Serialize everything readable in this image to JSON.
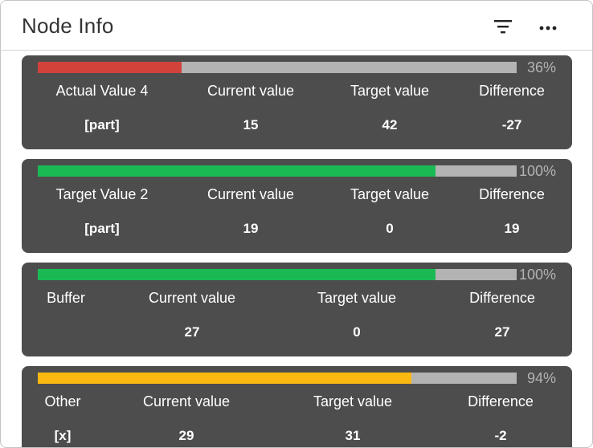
{
  "header": {
    "title": "Node Info",
    "filter_icon": "filter-icon",
    "more_icon": "more-horizontal-icon"
  },
  "colors": {
    "card_bg": "#4d4d4d",
    "track": "#b3b3b3",
    "red": "#d2423b",
    "green": "#1bb954",
    "amber": "#fbb911"
  },
  "cards": [
    {
      "percent": "36%",
      "progress": 0.3,
      "bar_color": "#d2423b",
      "name": "Actual Value 4",
      "current_label": "Current value",
      "target_label": "Target value",
      "diff_label": "Difference",
      "unit": "[part]",
      "current": "15",
      "target": "42",
      "diff": "-27"
    },
    {
      "percent": "100%",
      "progress": 0.83,
      "bar_color": "#1bb954",
      "name": "Target Value 2",
      "current_label": "Current value",
      "target_label": "Target value",
      "diff_label": "Difference",
      "unit": "[part]",
      "current": "19",
      "target": "0",
      "diff": "19"
    },
    {
      "percent": "100%",
      "progress": 0.83,
      "bar_color": "#1bb954",
      "name": "Buffer",
      "current_label": "Current value",
      "target_label": "Target value",
      "diff_label": "Difference",
      "unit": "",
      "current": "27",
      "target": "0",
      "diff": "27"
    },
    {
      "percent": "94%",
      "progress": 0.78,
      "bar_color": "#fbb911",
      "name": "Other",
      "current_label": "Current value",
      "target_label": "Target value",
      "diff_label": "Difference",
      "unit": "[x]",
      "current": "29",
      "target": "31",
      "diff": "-2"
    }
  ]
}
